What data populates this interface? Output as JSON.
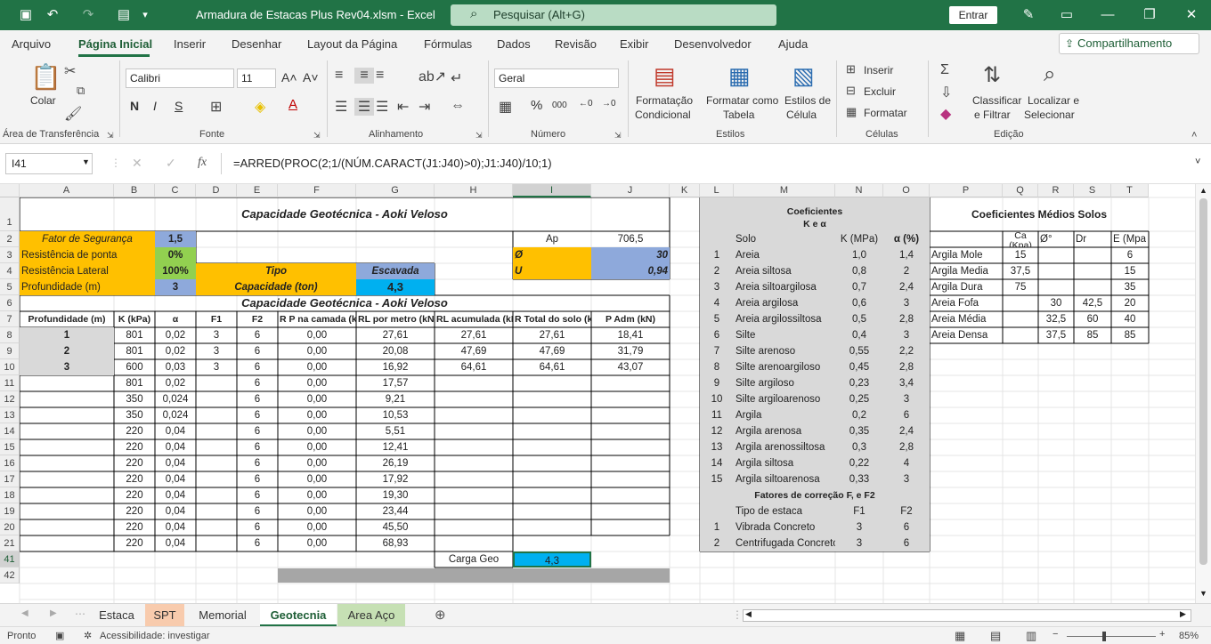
{
  "window": {
    "title": "Armadura de Estacas Plus Rev04.xlsm  -  Excel",
    "search_placeholder": "Pesquisar (Alt+G)",
    "signin_label": "Entrar"
  },
  "menu": {
    "tabs": [
      "Arquivo",
      "Página Inicial",
      "Inserir",
      "Desenhar",
      "Layout da Página",
      "Fórmulas",
      "Dados",
      "Revisão",
      "Exibir",
      "Desenvolvedor",
      "Ajuda"
    ],
    "active": "Página Inicial",
    "share_label": "Compartilhamento"
  },
  "ribbon": {
    "paste_label": "Colar",
    "font_name": "Calibri",
    "font_size": "11",
    "number_format": "Geral",
    "cond_format": [
      "Formatação",
      "Condicional"
    ],
    "format_table": [
      "Formatar como",
      "Tabela"
    ],
    "cell_styles": [
      "Estilos de",
      "Célula"
    ],
    "insert": "Inserir",
    "delete": "Excluir",
    "format": "Formatar",
    "sort": [
      "Classificar",
      "e Filtrar"
    ],
    "find": [
      "Localizar e",
      "Selecionar"
    ],
    "groups": [
      "Área de Transferência",
      "Fonte",
      "Alinhamento",
      "Número",
      "Estilos",
      "Células",
      "Edição"
    ]
  },
  "formula_bar": {
    "name_box": "I41",
    "formula": "=ARRED(PROC(2;1/(NÚM.CARACT(J1:J40)>0);J1:J40)/10;1)"
  },
  "columns": [
    "A",
    "B",
    "C",
    "D",
    "E",
    "F",
    "G",
    "H",
    "I",
    "J",
    "K",
    "L",
    "M",
    "N",
    "O",
    "P",
    "Q",
    "R",
    "S",
    "T"
  ],
  "rows": [
    "1",
    "2",
    "3",
    "4",
    "5",
    "6",
    "7",
    "8",
    "9",
    "10",
    "11",
    "12",
    "13",
    "14",
    "15",
    "16",
    "17",
    "18",
    "19",
    "20",
    "21",
    "41",
    "42"
  ],
  "sheet": {
    "title_main": "Capacidade Geotécnica - Aoki Veloso",
    "fs_label": "Fator de Segurança",
    "fs_value": "1,5",
    "rp_label": "Resistência de ponta",
    "rp_value": "0%",
    "rl_label": "Resistência Lateral",
    "rl_value": "100%",
    "tipo_label": "Tipo",
    "tipo_value": "Escavada",
    "prof_label": "Profundidade (m)",
    "prof_value": "3",
    "cap_label": "Capacidade (ton)",
    "cap_value": "4,3",
    "ap_label": "Ap",
    "ap_value": "706,5",
    "phi_label": "Ø",
    "phi_value": "30",
    "u_label": "U",
    "u_value": "0,94",
    "title_2": "Capacidade Geotécnica - Aoki Veloso",
    "headers": [
      "Profundidade (m)",
      "K (kPa)",
      "α",
      "F1",
      "F2",
      "R P na camada (kN)",
      "RL por metro (kN)",
      "RL acumulada (kN)",
      "R Total do solo (kN)",
      "P Adm (kN)"
    ],
    "rows": [
      [
        "1",
        "801",
        "0,02",
        "3",
        "6",
        "0,00",
        "27,61",
        "27,61",
        "27,61",
        "18,41"
      ],
      [
        "2",
        "801",
        "0,02",
        "3",
        "6",
        "0,00",
        "20,08",
        "47,69",
        "47,69",
        "31,79"
      ],
      [
        "3",
        "600",
        "0,03",
        "3",
        "6",
        "0,00",
        "16,92",
        "64,61",
        "64,61",
        "43,07"
      ],
      [
        "",
        "801",
        "0,02",
        "",
        "6",
        "0,00",
        "17,57",
        "",
        "",
        ""
      ],
      [
        "",
        "350",
        "0,024",
        "",
        "6",
        "0,00",
        "9,21",
        "",
        "",
        ""
      ],
      [
        "",
        "350",
        "0,024",
        "",
        "6",
        "0,00",
        "10,53",
        "",
        "",
        ""
      ],
      [
        "",
        "220",
        "0,04",
        "",
        "6",
        "0,00",
        "5,51",
        "",
        "",
        ""
      ],
      [
        "",
        "220",
        "0,04",
        "",
        "6",
        "0,00",
        "12,41",
        "",
        "",
        ""
      ],
      [
        "",
        "220",
        "0,04",
        "",
        "6",
        "0,00",
        "26,19",
        "",
        "",
        ""
      ],
      [
        "",
        "220",
        "0,04",
        "",
        "6",
        "0,00",
        "17,92",
        "",
        "",
        ""
      ],
      [
        "",
        "220",
        "0,04",
        "",
        "6",
        "0,00",
        "19,30",
        "",
        "",
        ""
      ],
      [
        "",
        "220",
        "0,04",
        "",
        "6",
        "0,00",
        "23,44",
        "",
        "",
        ""
      ],
      [
        "",
        "220",
        "0,04",
        "",
        "6",
        "0,00",
        "45,50",
        "",
        "",
        ""
      ],
      [
        "",
        "220",
        "0,04",
        "",
        "6",
        "0,00",
        "68,93",
        "",
        "",
        ""
      ]
    ],
    "carga_label": "Carga Geo",
    "carga_value": "4,3",
    "coef_title": "Coeficientes",
    "coef_sub": "K e α",
    "coef_headers": [
      "Solo",
      "K (MPa)",
      "α (%)"
    ],
    "coef_rows": [
      [
        "1",
        "Areia",
        "1,0",
        "1,4"
      ],
      [
        "2",
        "Areia siltosa",
        "0,8",
        "2"
      ],
      [
        "3",
        "Areia siltoargilosa",
        "0,7",
        "2,4"
      ],
      [
        "4",
        "Areia argilosa",
        "0,6",
        "3"
      ],
      [
        "5",
        "Areia argilossiltosa",
        "0,5",
        "2,8"
      ],
      [
        "6",
        "Silte",
        "0,4",
        "3"
      ],
      [
        "7",
        "Silte arenoso",
        "0,55",
        "2,2"
      ],
      [
        "8",
        "Silte arenoargiloso",
        "0,45",
        "2,8"
      ],
      [
        "9",
        "Silte argiloso",
        "0,23",
        "3,4"
      ],
      [
        "10",
        "Silte argiloarenoso",
        "0,25",
        "3"
      ],
      [
        "11",
        "Argila",
        "0,2",
        "6"
      ],
      [
        "12",
        "Argila arenosa",
        "0,35",
        "2,4"
      ],
      [
        "13",
        "Argila arenossiltosa",
        "0,3",
        "2,8"
      ],
      [
        "14",
        "Argila siltosa",
        "0,22",
        "4"
      ],
      [
        "15",
        "Argila siltoarenosa",
        "0,33",
        "3"
      ]
    ],
    "fat_title": "Fatores de correção F, e F2",
    "fat_headers": [
      "Tipo de estaca",
      "F1",
      "F2"
    ],
    "fat_rows": [
      [
        "1",
        "Vibrada Concreto",
        "3",
        "6"
      ],
      [
        "2",
        "Centrifugada Concreto",
        "3",
        "6"
      ]
    ],
    "med_title": "Coeficientes Médios Solos",
    "med_headers": [
      "Ca (Kpa)",
      "Ø°",
      "Dr",
      "E (Mpa"
    ],
    "med_rows": [
      [
        "Argila Mole",
        "15",
        "",
        "",
        "6"
      ],
      [
        "Argila Media",
        "37,5",
        "",
        "",
        "15"
      ],
      [
        "Argila Dura",
        "75",
        "",
        "",
        "35"
      ],
      [
        "Areia Fofa",
        "",
        "30",
        "42,5",
        "20"
      ],
      [
        "Areia Média",
        "",
        "32,5",
        "60",
        "40"
      ],
      [
        "Areia Densa",
        "",
        "37,5",
        "85",
        "85"
      ]
    ]
  },
  "tabs": [
    "Estaca",
    "SPT",
    "Memorial",
    "Geotecnia",
    "Area Aço"
  ],
  "status": {
    "ready": "Pronto",
    "accessibility": "Acessibilidade: investigar",
    "zoom": "85%"
  },
  "colors": {
    "excel_green": "#217346",
    "orange": "#ffc000",
    "blue": "#8ea9db",
    "cyan": "#00b0f0",
    "green": "#92d050",
    "grey": "#d9d9d9"
  }
}
